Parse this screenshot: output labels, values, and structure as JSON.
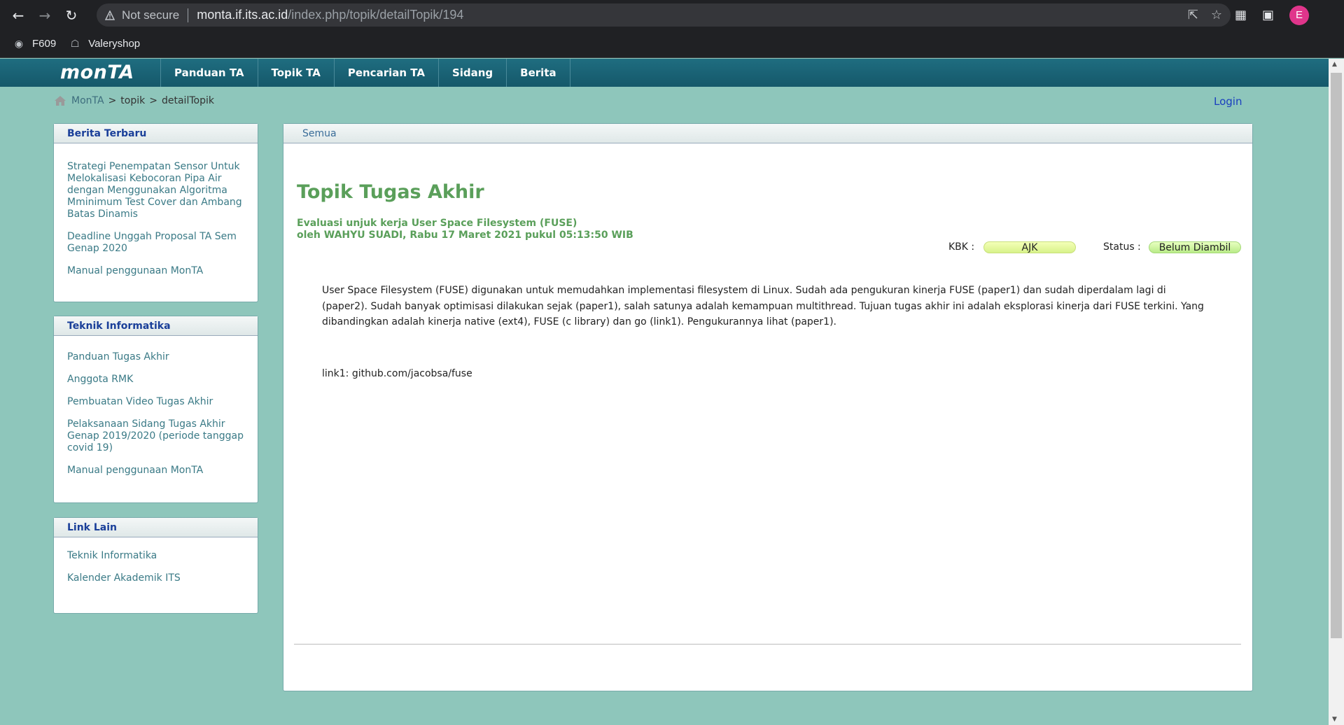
{
  "browser": {
    "not_secure": "Not secure",
    "url_host": "monta.if.its.ac.id",
    "url_path": "/index.php/topik/detailTopik/194",
    "profile_initial": "E",
    "bookmarks": [
      {
        "label": "F609",
        "icon": "globe-icon"
      },
      {
        "label": "Valeryshop",
        "icon": "shop-icon"
      }
    ]
  },
  "site": {
    "logo": "monTA",
    "menu": [
      "Panduan TA",
      "Topik TA",
      "Pencarian TA",
      "Sidang",
      "Berita"
    ],
    "breadcrumb": [
      "MonTA",
      "topik",
      "detailTopik"
    ],
    "login": "Login"
  },
  "sidebar": {
    "berita": {
      "title": "Berita Terbaru",
      "items": [
        "Strategi Penempatan Sensor Untuk Melokalisasi Kebocoran Pipa Air dengan Menggunakan Algoritma Mminimum Test Cover dan Ambang Batas Dinamis",
        "Deadline Unggah Proposal TA Sem Genap 2020",
        "Manual penggunaan MonTA"
      ]
    },
    "teknik": {
      "title": "Teknik Informatika",
      "items": [
        "Panduan Tugas Akhir",
        "Anggota RMK",
        "Pembuatan Video Tugas Akhir",
        "Pelaksanaan Sidang Tugas Akhir Genap 2019/2020 (periode tanggap covid 19)",
        "Manual penggunaan MonTA"
      ]
    },
    "link_lain": {
      "title": "Link Lain",
      "items": [
        "Teknik Informatika",
        "Kalender Akademik ITS"
      ]
    }
  },
  "main": {
    "tab": "Semua",
    "page_title": "Topik Tugas Akhir",
    "topic_title": "Evaluasi unjuk kerja User Space Filesystem (FUSE)",
    "topic_meta": "oleh WAHYU SUADI, Rabu 17 Maret 2021 pukul 05:13:50 WIB",
    "kbk_label": "KBK :",
    "kbk_value": "AJK",
    "status_label": "Status :",
    "status_value": "Belum Diambil",
    "description": "User Space Filesystem (FUSE) digunakan untuk memudahkan implementasi filesystem di Linux. Sudah ada pengukuran kinerja FUSE (paper1) dan sudah diperdalam lagi di (paper2). Sudah banyak optimisasi dilakukan sejak (paper1), salah satunya adalah kemampuan multithread. Tujuan tugas akhir ini adalah eksplorasi kinerja dari FUSE terkini. Yang dibandingkan adalah kinerja native (ext4), FUSE (c library) dan go (link1). Pengukurannya lihat (paper1).",
    "link_text": "link1: github.com/jacobsa/fuse"
  },
  "colors": {
    "page_bg": "#8ec6bb",
    "header_bg": "#1a6477",
    "title_green": "#5a9f5a",
    "sidebar_link": "#3a7a86",
    "sidebar_heading": "#1a3f99"
  }
}
